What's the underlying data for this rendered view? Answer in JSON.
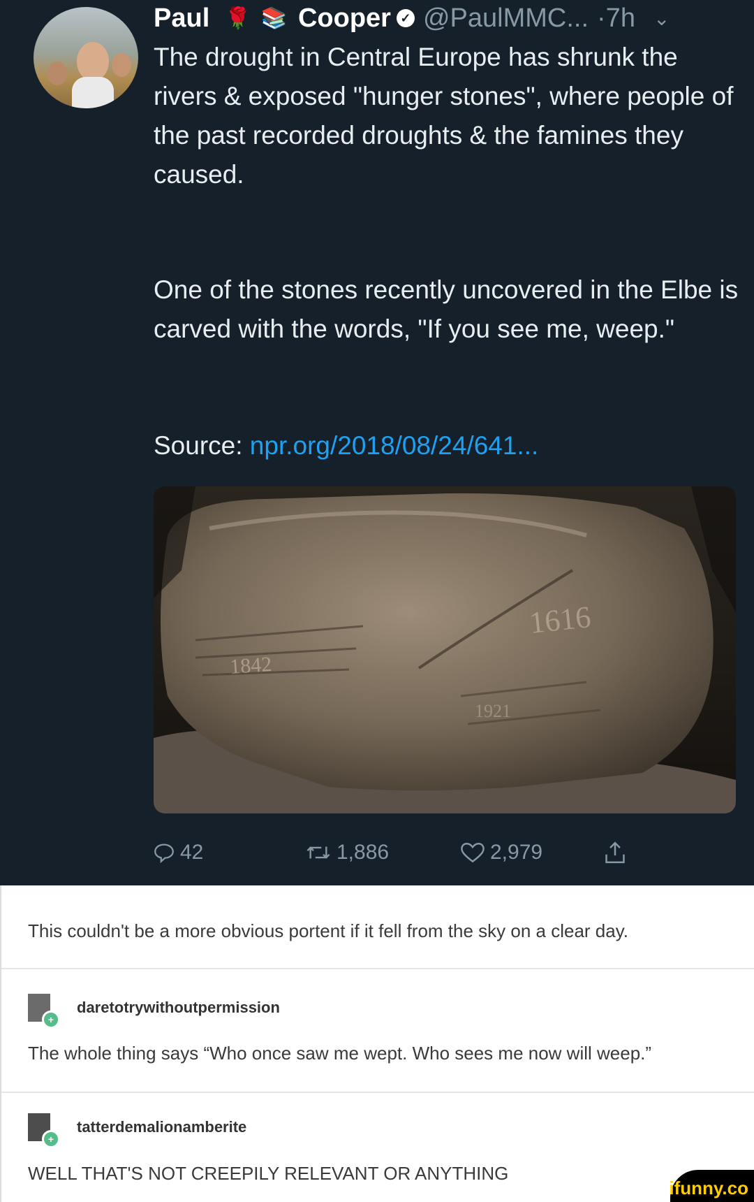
{
  "tweet": {
    "author": {
      "first_name": "Paul",
      "last_name": "Cooper",
      "handle": "@PaulMMC...",
      "time": "·7h",
      "verified": true
    },
    "paragraph1": "The drought in Central Europe has shrunk the rivers & exposed \"hunger stones\", where people of the past recorded droughts & the famines they caused.",
    "paragraph2": "One of the stones recently uncovered in the Elbe is carved with the words, \"If you see me, weep.\"",
    "source_label": "Source:",
    "source_link": "npr.org/2018/08/24/641...",
    "stone_inscriptions": [
      "1616",
      "1921",
      "1842"
    ],
    "actions": {
      "replies": "42",
      "retweets": "1,886",
      "likes": "2,979"
    }
  },
  "tumblr": {
    "op_comment": "This couldn't be a more obvious portent if it fell from the sky on a clear day.",
    "replies": [
      {
        "username": "daretotrywithoutpermission",
        "text": "The whole thing says “Who once saw me wept. Who sees me now will weep.”"
      },
      {
        "username": "tatterdemalionamberite",
        "text": "WELL THAT'S NOT CREEPILY RELEVANT OR ANYTHING"
      }
    ]
  },
  "watermark": "ifunny.co",
  "colors": {
    "tweet_bg": "#15202b",
    "link": "#1da1f2",
    "tumblr_bg": "#ffffff",
    "watermark": "#ffcc00"
  }
}
